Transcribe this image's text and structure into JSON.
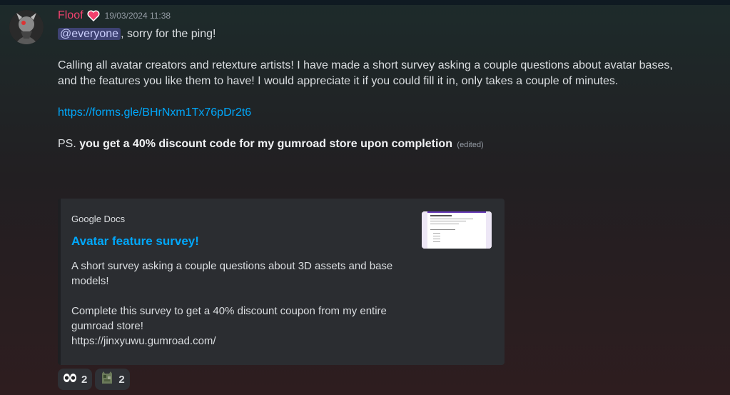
{
  "message": {
    "username": "Floof",
    "username_color": "#f2426e",
    "badge_icon": "heart-icon",
    "timestamp": "19/03/2024 11:38",
    "mention": "@everyone",
    "line1_rest": ", sorry for the ping!",
    "paragraph": "Calling all avatar creators and retexture artists! I have made a short survey asking a couple questions about avatar bases, and the features you like them to have! I would appreciate it if you could fill it in, only takes a couple of minutes.",
    "link": "https://forms.gle/BHrNxm1Tx76pDr2t6",
    "ps_prefix": "PS. ",
    "ps_bold": "you get a 40% discount code for my gumroad store upon completion",
    "edited": "(edited)"
  },
  "embed": {
    "provider": "Google Docs",
    "title": "Avatar feature survey!",
    "description": "A short survey asking a couple questions about 3D assets and base models!\n\nComplete this survey to get a 40% discount coupon from my entire gumroad store!\nhttps://jinxyuwu.gumroad.com/",
    "thumbnail_icon": "form-preview-thumbnail",
    "link_color": "#00a8fc"
  },
  "reactions": [
    {
      "emoji": "eyes-icon",
      "count": "2"
    },
    {
      "emoji": "cat-emoji-icon",
      "count": "2"
    }
  ]
}
